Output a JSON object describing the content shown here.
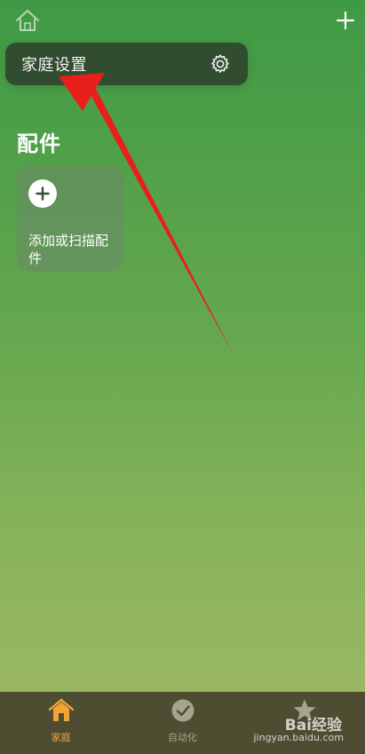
{
  "header": {
    "home_icon": "home-outline-icon",
    "add_icon": "plus-icon"
  },
  "popup_menu": {
    "home_settings_label": "家庭设置",
    "settings_icon": "gear-icon"
  },
  "accessories_section": {
    "title": "配件",
    "add_tile": {
      "icon": "plus-circle-icon",
      "label": "添加或扫描配件"
    }
  },
  "tab_bar": {
    "tabs": [
      {
        "label": "家庭",
        "icon": "home-filled-icon",
        "active": true
      },
      {
        "label": "自动化",
        "icon": "clock-check-icon",
        "active": false
      },
      {
        "label": "",
        "icon": "star-icon",
        "active": false
      }
    ]
  },
  "watermark": {
    "brand": "Bai经验",
    "url": "jingyan.baidu.com"
  },
  "colors": {
    "accent_active": "#f2a33a",
    "tab_inactive": "#a6a38e",
    "annotation_arrow": "#e8201c",
    "tab_bar_bg": "#4e4d31"
  }
}
